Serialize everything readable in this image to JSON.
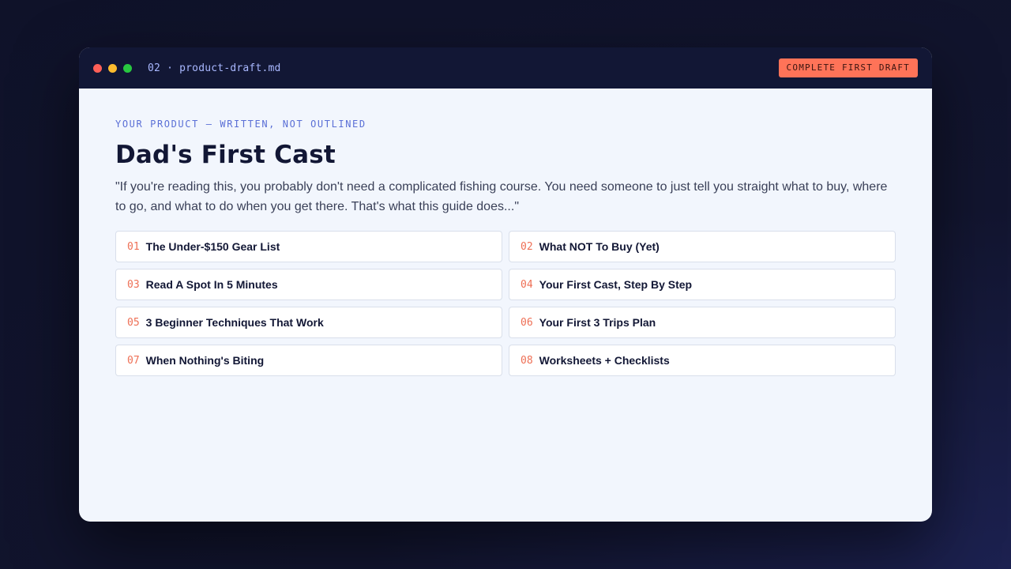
{
  "window": {
    "file_name": "02 · product-draft.md",
    "badge": "COMPLETE FIRST DRAFT"
  },
  "product": {
    "eyebrow": "YOUR PRODUCT — WRITTEN, NOT OUTLINED",
    "title": "Dad's First Cast",
    "intro": "\"If you're reading this, you probably don't need a complicated fishing course. You need someone to just tell you straight what to buy, where to go, and what to do when you get there. That's what this guide does...\""
  },
  "chapters": [
    {
      "num": "01",
      "label": "The Under-$150 Gear List"
    },
    {
      "num": "02",
      "label": "What NOT To Buy (Yet)"
    },
    {
      "num": "03",
      "label": "Read A Spot In 5 Minutes"
    },
    {
      "num": "04",
      "label": "Your First Cast, Step By Step"
    },
    {
      "num": "05",
      "label": "3 Beginner Techniques That Work"
    },
    {
      "num": "06",
      "label": "Your First 3 Trips Plan"
    },
    {
      "num": "07",
      "label": "When Nothing's Biting"
    },
    {
      "num": "08",
      "label": "Worksheets + Checklists"
    }
  ],
  "colors": {
    "accent": "#ff7358",
    "chapter_number": "#ee6f55",
    "eyebrow": "#5a6fd6",
    "titlebar": "#121735"
  }
}
